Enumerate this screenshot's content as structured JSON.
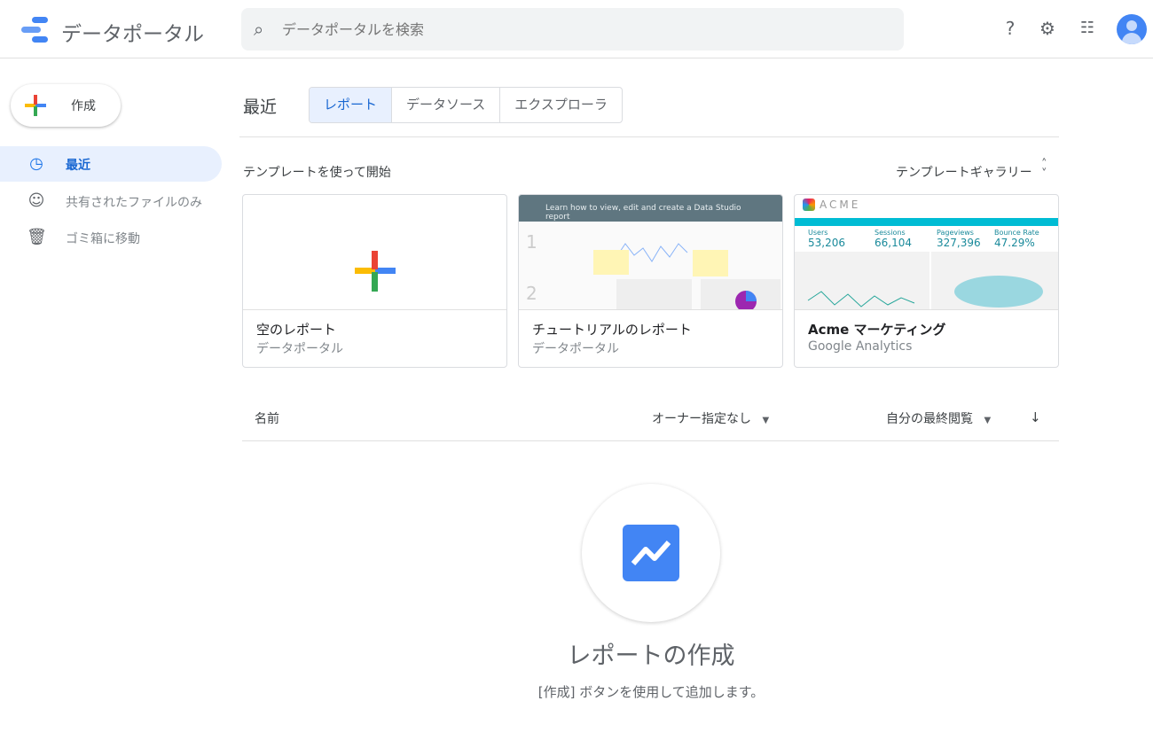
{
  "header": {
    "app_title": "データポータル",
    "search_placeholder": "データポータルを検索"
  },
  "sidebar": {
    "create_label": "作成",
    "items": [
      {
        "label": "最近"
      },
      {
        "label": "共有されたファイルのみ"
      },
      {
        "label": "ゴミ箱に移動"
      }
    ]
  },
  "main": {
    "title": "最近",
    "tabs": [
      {
        "label": "レポート"
      },
      {
        "label": "データソース"
      },
      {
        "label": "エクスプローラ"
      }
    ],
    "templates_heading": "テンプレートを使って開始",
    "gallery_label": "テンプレートギャラリー",
    "templates": [
      {
        "name": "空のレポート",
        "source": "データポータル"
      },
      {
        "name": "チュートリアルのレポート",
        "source": "データポータル",
        "thumb_title": "Learn how to view, edit and create a Data Studio report"
      },
      {
        "name": "Acme マーケティング",
        "source": "Google Analytics",
        "thumb_logo": "ACME",
        "thumb_stats": [
          {
            "label": "Users",
            "value": "53,206"
          },
          {
            "label": "Sessions",
            "value": "66,104"
          },
          {
            "label": "Pageviews",
            "value": "327,396"
          },
          {
            "label": "Bounce Rate",
            "value": "47.29%"
          }
        ]
      }
    ],
    "columns": {
      "name": "名前",
      "owner": "オーナー指定なし",
      "last_viewed": "自分の最終閲覧"
    },
    "empty": {
      "title": "レポートの作成",
      "subtitle": "[作成] ボタンを使用して追加します。"
    }
  }
}
